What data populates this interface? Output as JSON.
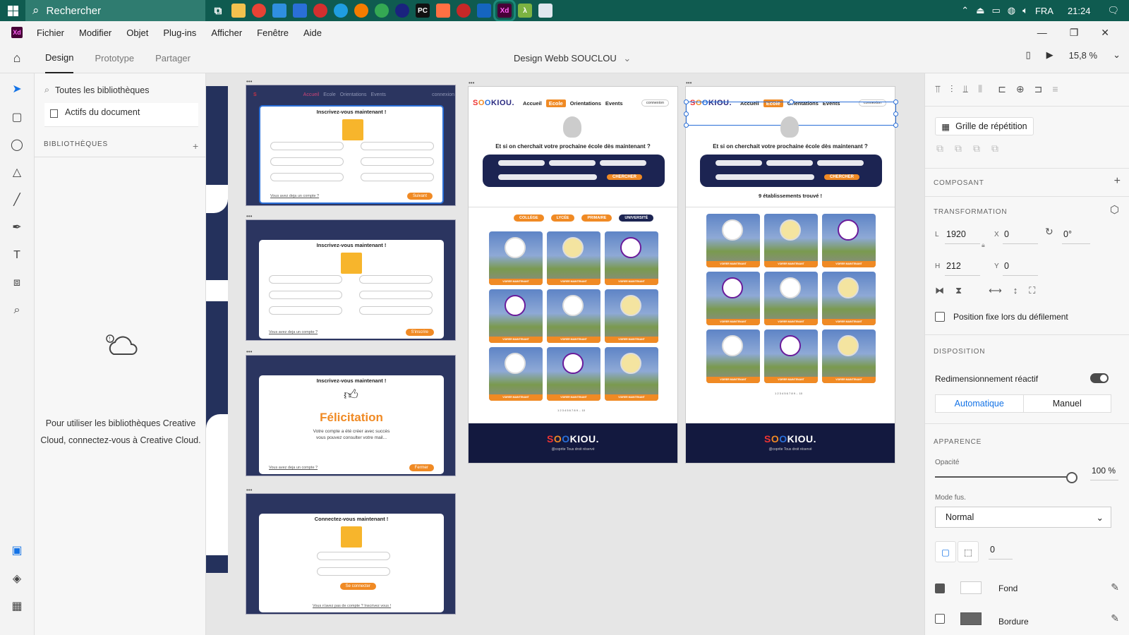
{
  "taskbar": {
    "search_placeholder": "Rechercher",
    "language": "FRA",
    "time": "21:24"
  },
  "menubar": {
    "app_badge": "Xd",
    "items": [
      "Fichier",
      "Modifier",
      "Objet",
      "Plug-ins",
      "Afficher",
      "Fenêtre",
      "Aide"
    ]
  },
  "topbar": {
    "tabs": [
      "Design",
      "Prototype",
      "Partager"
    ],
    "document_title": "Design Webb SOUCLOU",
    "zoom": "15,8 %"
  },
  "libraries": {
    "search_label": "Toutes les bibliothèques",
    "assets_label": "Actifs du document",
    "section_title": "BIBLIOTHÈQUES",
    "message": "Pour utiliser les bibliothèques Creative Cloud, connectez-vous à Creative Cloud."
  },
  "canvas": {
    "modals": [
      {
        "title": "Inscrivez-vous maintenant !",
        "footer": "Vous avez deja un compte ?",
        "button": "Suivant",
        "nav": [
          "Accueil",
          "Ecole",
          "Orientations",
          "Events"
        ],
        "login": "connexion"
      },
      {
        "title": "Inscrivez-vous maintenant !",
        "footer": "Vous avez deja un compte ?",
        "button": "S'inscrire"
      },
      {
        "title": "Inscrivez-vous maintenant !",
        "headline": "Félicitation",
        "sub1": "Votre compte a été créer avec succès",
        "sub2": "vous pouvez consulter votre mail...",
        "footer": "Vous avez deja un compte ?",
        "button": "Fermer"
      },
      {
        "title": "Connectez-vous maintenant !",
        "button": "Se connecter",
        "footer": "Vous n'avez pas de compte ? Inscrivez vous !"
      }
    ],
    "site": {
      "logo": [
        "S",
        "O",
        "O",
        "KIOU."
      ],
      "nav": [
        "Accueil",
        "Ecole",
        "Orientations",
        "Events"
      ],
      "login": "connexion",
      "hero_title": "Et si on cherchait votre prochaine école dès maintenant ?",
      "search_button": "CHERCHER",
      "chips": [
        "COLLÈGE",
        "LYCÉE",
        "PRIMAIRE",
        "UNIVERSITÉ"
      ],
      "card_label": "VOIRER MAINTENANT",
      "found_text": "9 établissements trouvé !",
      "pager": "1 2 3 4 5 6 7 8 9 ... 10",
      "footer_copy": "@coprite Tous droit réservé"
    }
  },
  "properties": {
    "repeat_grid": "Grille de répétition",
    "component_title": "COMPOSANT",
    "transform_title": "TRANSFORMATION",
    "w_label": "L",
    "w_value": "1920",
    "h_label": "H",
    "h_value": "212",
    "x_label": "X",
    "x_value": "0",
    "y_label": "Y",
    "y_value": "0",
    "rotation": "0°",
    "fixed_position": "Position fixe lors du défilement",
    "layout_title": "DISPOSITION",
    "responsive_resize": "Redimensionnement réactif",
    "auto": "Automatique",
    "manual": "Manuel",
    "appearance_title": "APPARENCE",
    "opacity_label": "Opacité",
    "opacity_value": "100 %",
    "blend_label": "Mode fus.",
    "blend_value": "Normal",
    "radius_value": "0",
    "fill_label": "Fond",
    "border_label": "Bordure"
  }
}
